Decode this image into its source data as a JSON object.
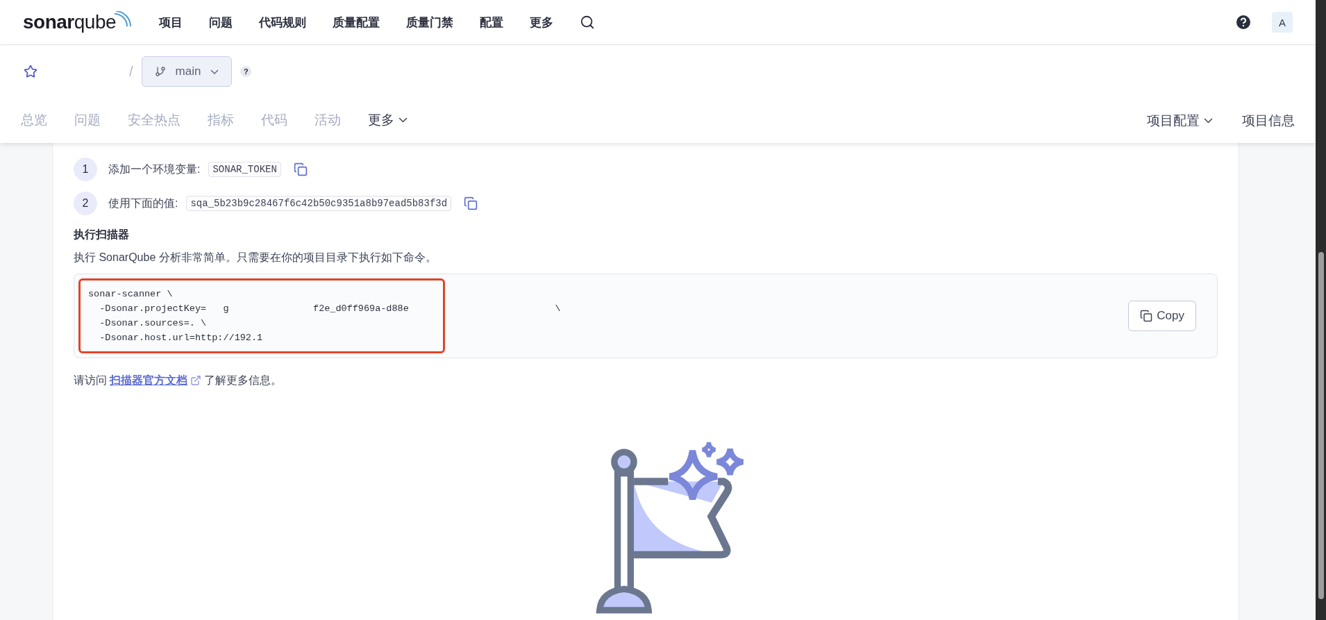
{
  "top_nav": {
    "logo": {
      "prefix": "sonar",
      "suffix": "qube"
    },
    "items": [
      {
        "label": "项目"
      },
      {
        "label": "问题"
      },
      {
        "label": "代码规则"
      },
      {
        "label": "质量配置"
      },
      {
        "label": "质量门禁"
      },
      {
        "label": "配置"
      },
      {
        "label": "更多"
      }
    ],
    "avatar": "A"
  },
  "project_header": {
    "starred": false,
    "separator": "/",
    "branch": "main",
    "help": "?"
  },
  "project_tabs": [
    {
      "label": "总览",
      "selected": false,
      "kind": "tab"
    },
    {
      "label": "问题",
      "selected": false,
      "kind": "tab"
    },
    {
      "label": "安全热点",
      "selected": false,
      "kind": "tab"
    },
    {
      "label": "指标",
      "selected": false,
      "kind": "tab"
    },
    {
      "label": "代码",
      "selected": false,
      "kind": "tab"
    },
    {
      "label": "活动",
      "selected": false,
      "kind": "tab"
    },
    {
      "label": "更多",
      "selected": false,
      "kind": "menu"
    }
  ],
  "project_actions": [
    {
      "label": "项目配置",
      "kind": "menu"
    },
    {
      "label": "项目信息",
      "kind": "link"
    }
  ],
  "steps": [
    {
      "number": "1",
      "label": "添加一个环境变量:",
      "value": "SONAR_TOKEN"
    },
    {
      "number": "2",
      "label": "使用下面的值:",
      "value": "sqa_5b23b9c28467f6c42b50c9351a8b97ead5b83f3d"
    }
  ],
  "scanner": {
    "title": "执行扫描器",
    "description": "执行 SonarQube 分析非常简单。只需要在你的项目目录下执行如下命令。",
    "code_lines": [
      "sonar-scanner \\",
      "  -Dsonar.projectKey=   g               f2e_d0ff969a-d88e                          \\",
      "  -Dsonar.sources=. \\",
      "  -Dsonar.host.url=http://192.1"
    ],
    "highlighted": true,
    "copy_button": "Copy",
    "footer": {
      "before": "请访问",
      "link": "扫描器官方文档",
      "after": "了解更多信息。"
    }
  }
}
